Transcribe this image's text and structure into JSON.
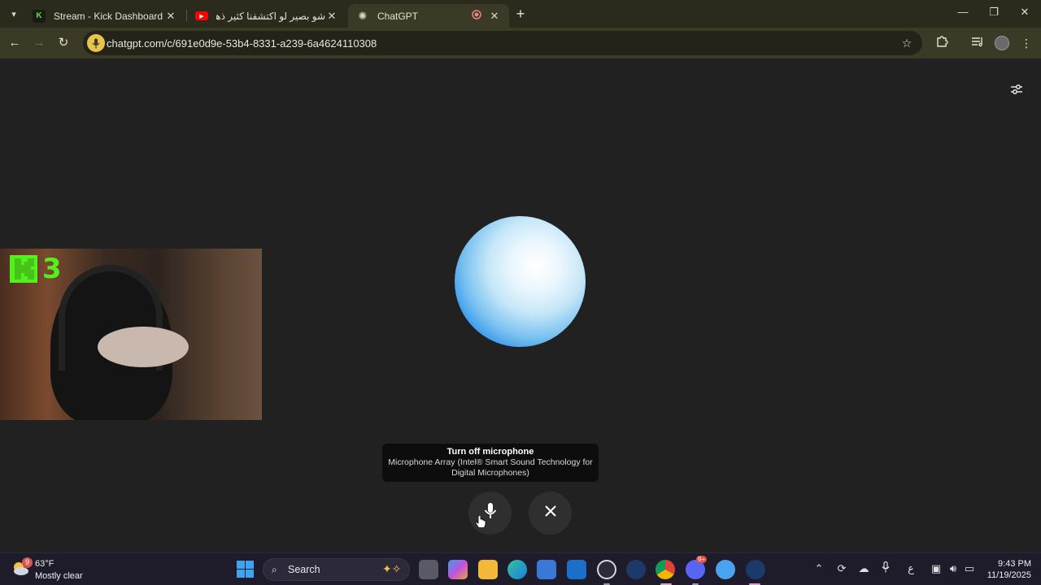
{
  "browser": {
    "tabs": [
      {
        "title": "Stream - Kick Dashboard",
        "icon": "kick-icon"
      },
      {
        "title": "شو بصير لو اكتشفنا كثير ذهب؟ -",
        "icon": "youtube-icon"
      },
      {
        "title": "ChatGPT",
        "icon": "chatgpt-icon",
        "active": true
      }
    ],
    "url": "chatgpt.com/c/691e0d9e-53b4-8331-a239-6a4624110308"
  },
  "voice": {
    "tooltip_title": "Turn off microphone",
    "tooltip_sub": "Microphone Array (Intel® Smart Sound Technology for Digital Microphones)"
  },
  "webcam": {
    "viewer_count": "3"
  },
  "taskbar": {
    "weather_badge": "9",
    "temperature": "63°F",
    "condition": "Mostly clear",
    "search_label": "Search",
    "input_lang": "ع",
    "time": "9:43 PM",
    "date": "11/19/2025",
    "discord_badge": "9+"
  },
  "colors": {
    "accent_yellow": "#e9c34a",
    "kick_green": "#52f01d",
    "windows_blue": "#3ea4f0"
  }
}
